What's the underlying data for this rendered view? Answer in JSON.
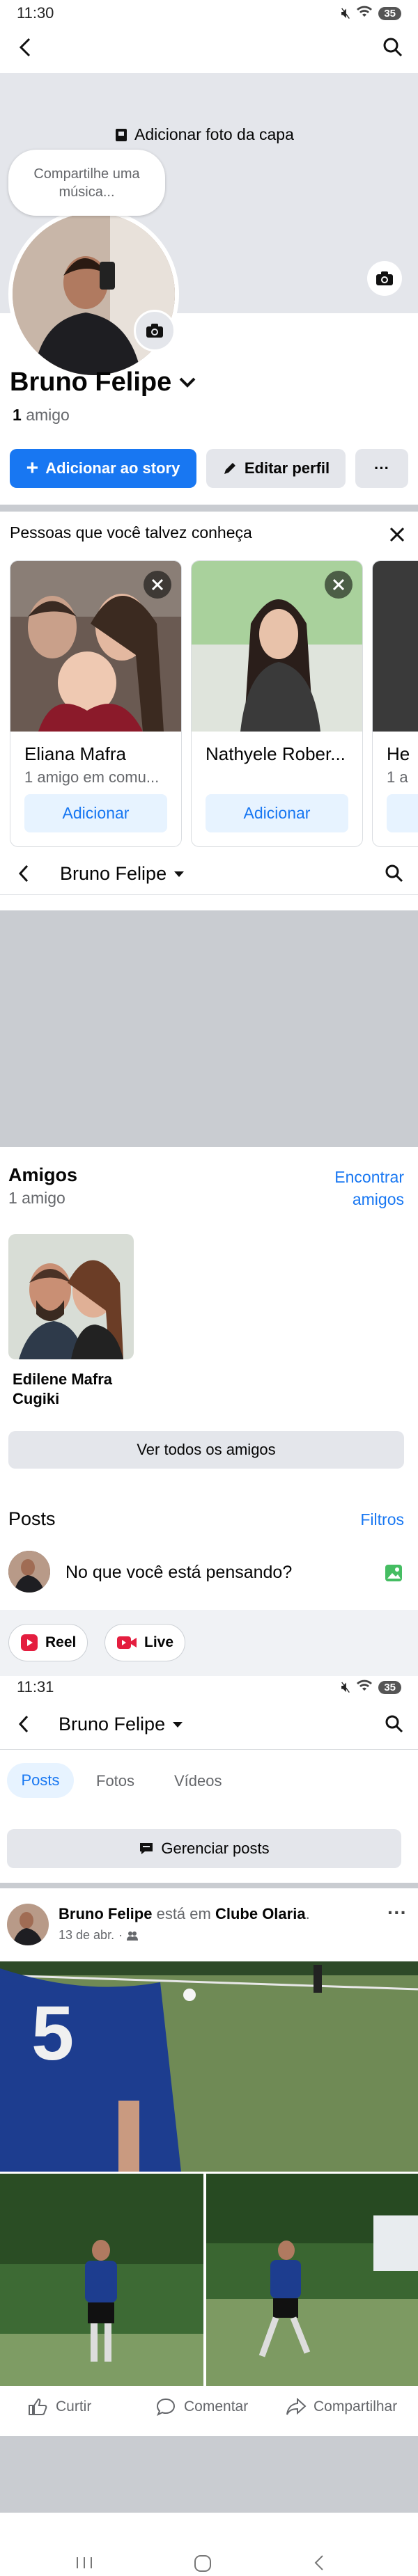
{
  "status_bar_1": {
    "time": "11:30",
    "battery": "35"
  },
  "status_bar_2": {
    "time": "11:31",
    "battery": "35"
  },
  "cover": {
    "add_cover_label": "Adicionar foto da capa",
    "music_bubble": "Compartilhe uma música..."
  },
  "profile": {
    "name": "Bruno Felipe",
    "friend_count": "1",
    "friend_word": "amigo"
  },
  "actions": {
    "add_story": "Adicionar ao story",
    "edit_profile": "Editar perfil",
    "more": "···"
  },
  "pymk": {
    "title": "Pessoas que você talvez conheça",
    "cards": [
      {
        "name": "Eliana Mafra",
        "mutual": "1 amigo em comu...",
        "add": "Adicionar"
      },
      {
        "name": "Nathyele Rober...",
        "mutual": "",
        "add": "Adicionar"
      },
      {
        "name": "He",
        "mutual": "1 a",
        "add": ""
      }
    ]
  },
  "sticky_header": {
    "name": "Bruno Felipe"
  },
  "friends": {
    "title": "Amigos",
    "count": "1 amigo",
    "find_line1": "Encontrar",
    "find_line2": "amigos",
    "friend_name_line1": "Edilene Mafra",
    "friend_name_line2": "Cugiki",
    "see_all": "Ver todos os amigos"
  },
  "posts_section": {
    "title": "Posts",
    "filters": "Filtros",
    "composer_placeholder": "No que você está pensando?",
    "reel": "Reel",
    "live": "Live"
  },
  "header2": {
    "name": "Bruno Felipe"
  },
  "tabs": [
    "Posts",
    "Fotos",
    "Vídeos"
  ],
  "manage_posts": "Gerenciar posts",
  "post": {
    "author": "Bruno Felipe",
    "verb": "está em",
    "place": "Clube Olaria",
    "date": "13 de abr.",
    "jersey_number": "5",
    "like": "Curtir",
    "comment": "Comentar",
    "share": "Compartilhar"
  },
  "colors": {
    "accent": "#1877f2",
    "divider": "#c9ccd1",
    "light_gray": "#e4e6eb"
  }
}
